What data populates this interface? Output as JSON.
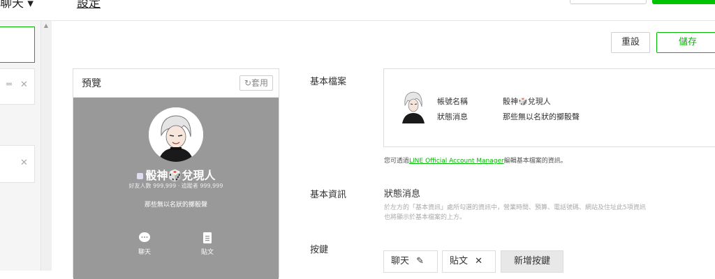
{
  "header": {
    "title": "聊天 ▾",
    "link": "設定"
  },
  "actions": {
    "reset_label": "重設",
    "save_label": "儲存"
  },
  "preview": {
    "title": "預覽",
    "apply_label": "套用",
    "account_name": "骰神🎲兌現人",
    "stats": "好友人數 999,999 · 追蹤者 999,999",
    "status_message": "那些無以名狀的擲骰聲",
    "actions": [
      {
        "label": "聊天",
        "icon": "chat-bubble-icon"
      },
      {
        "label": "貼文",
        "icon": "post-icon"
      }
    ]
  },
  "basic_profile": {
    "label": "基本檔案",
    "account_name_label": "帳號名稱",
    "account_name_value": "骰神🎲兌現人",
    "status_label": "狀態消息",
    "status_value": "那些無以名狀的擲骰聲",
    "note_prefix": "您可透過",
    "note_link": "LINE Official Account Manager",
    "note_suffix": "編輯基本檔案的資訊。"
  },
  "basic_info": {
    "label": "基本資訊",
    "sub_title": "狀態消息",
    "desc_line1": "於左方的「基本資訊」處所勾選的資訊中，營業時間、預算、電話號碼、網站及住址此5項資訊",
    "desc_line2": "也將顯示於基本檔案的上方。"
  },
  "buttons_section": {
    "label": "按鍵",
    "chips": [
      {
        "label": "聊天",
        "icon": "pencil-icon"
      },
      {
        "label": "貼文",
        "icon": "close-icon"
      }
    ],
    "add_label": "新增按鍵"
  },
  "colors": {
    "brand_green": "#00b900",
    "preview_bg": "#999999"
  }
}
